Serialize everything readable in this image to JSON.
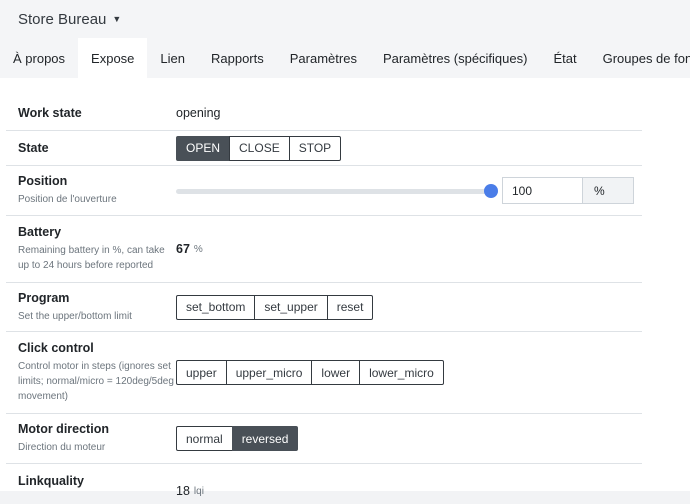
{
  "header": {
    "device_name": "Store Bureau"
  },
  "tabs": [
    {
      "label": "À propos"
    },
    {
      "label": "Expose"
    },
    {
      "label": "Lien"
    },
    {
      "label": "Rapports"
    },
    {
      "label": "Paramètres"
    },
    {
      "label": "Paramètres (spécifiques)"
    },
    {
      "label": "État"
    },
    {
      "label": "Groupes de fonctionnalité"
    }
  ],
  "active_tab": "Expose",
  "rows": {
    "work_state": {
      "title": "Work state",
      "value": "opening"
    },
    "state": {
      "title": "State",
      "buttons": [
        "OPEN",
        "CLOSE",
        "STOP"
      ],
      "active": "OPEN"
    },
    "position": {
      "title": "Position",
      "desc": "Position de l'ouverture",
      "value": "100",
      "unit": "%",
      "slider_fraction": 1.0
    },
    "battery": {
      "title": "Battery",
      "desc": "Remaining battery in %, can take up to 24 hours before reported",
      "value": "67",
      "unit": "%"
    },
    "program": {
      "title": "Program",
      "desc": "Set the upper/bottom limit",
      "buttons": [
        "set_bottom",
        "set_upper",
        "reset"
      ]
    },
    "click_control": {
      "title": "Click control",
      "desc": "Control motor in steps (ignores set limits; normal/micro = 120deg/5deg movement)",
      "buttons": [
        "upper",
        "upper_micro",
        "lower",
        "lower_micro"
      ]
    },
    "motor_direction": {
      "title": "Motor direction",
      "desc": "Direction du moteur",
      "buttons": [
        "normal",
        "reversed"
      ],
      "active": "reversed"
    },
    "linkquality": {
      "title": "Linkquality",
      "value": "18",
      "unit": "lqi"
    }
  },
  "colors": {
    "accent": "#4a7de8",
    "active_button": "#495057"
  }
}
